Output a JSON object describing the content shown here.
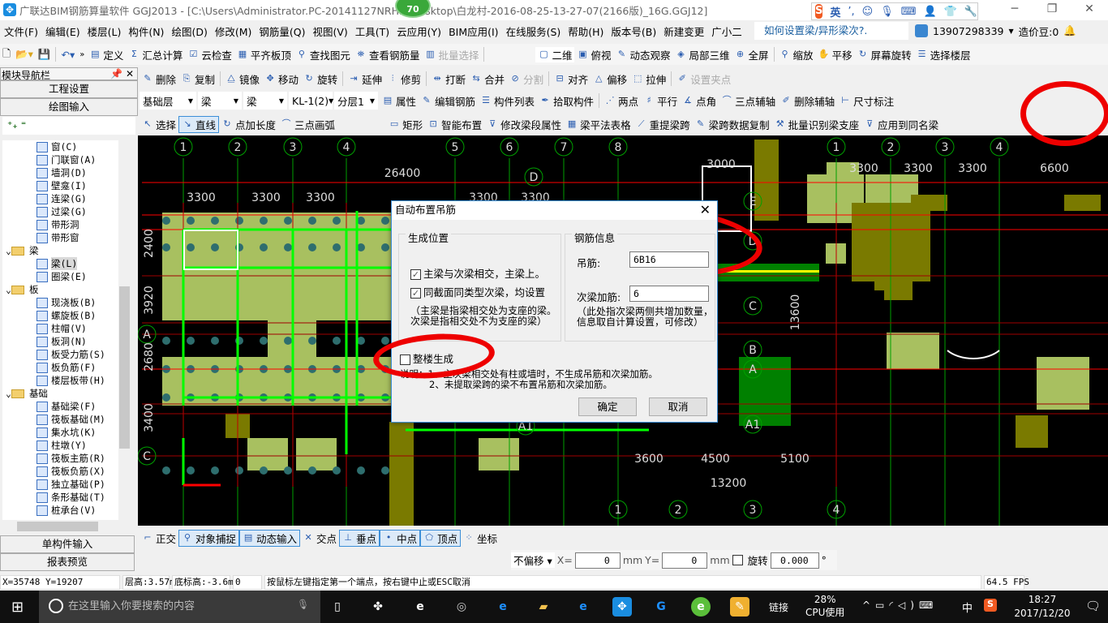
{
  "window": {
    "title": "广联达BIM钢筋算量软件 GGJ2013 - [C:\\Users\\Administrator.PC-20141127NRHM\\Desktop\\白龙村-2016-08-25-13-27-07(2166版)_16G.GGJ12]",
    "badge": "70",
    "ime": {
      "lang": "英",
      "punct": "’,"
    }
  },
  "menu": [
    "文件(F)",
    "编辑(E)",
    "楼层(L)",
    "构件(N)",
    "绘图(D)",
    "修改(M)",
    "钢筋量(Q)",
    "视图(V)",
    "工具(T)",
    "云应用(Y)",
    "BIM应用(I)",
    "在线服务(S)",
    "帮助(H)",
    "版本号(B)",
    "新建变更",
    "广小二"
  ],
  "help_query": "如何设置梁/异形梁次?.",
  "user": {
    "phone": "13907298339",
    "beans": "造价豆:0"
  },
  "toolbar1": [
    "定义",
    "汇总计算",
    "云检查",
    "平齐板顶",
    "查找图元",
    "查看钢筋量",
    "批量选择",
    "二维",
    "俯视",
    "动态观察",
    "局部三维",
    "全屏",
    "缩放",
    "平移",
    "屏幕旋转",
    "选择楼层"
  ],
  "toolbar2": [
    "删除",
    "复制",
    "镜像",
    "移动",
    "旋转",
    "延伸",
    "修剪",
    "打断",
    "合并",
    "分割",
    "对齐",
    "偏移",
    "拉伸",
    "设置夹点"
  ],
  "toolbar3": {
    "floor": "基础层",
    "type": "梁",
    "subtype": "梁",
    "component": "KL-1(2)",
    "layer": "分层1",
    "buttons": [
      "属性",
      "编辑钢筋",
      "构件列表",
      "拾取构件",
      "两点",
      "平行",
      "点角",
      "三点辅轴",
      "删除辅轴",
      "尺寸标注"
    ]
  },
  "toolbar4": [
    "选择",
    "直线",
    "点加长度",
    "三点画弧",
    "矩形",
    "智能布置",
    "修改梁段属性",
    "梁平法表格",
    "重提梁跨",
    "梁跨数据复制",
    "批量识别梁支座",
    "应用到同名梁"
  ],
  "nav": {
    "title": "模块导航栏",
    "project_settings": "工程设置",
    "drawing_input": "绘图输入",
    "single_input": "单构件输入",
    "report_preview": "报表预览"
  },
  "tree": [
    {
      "label": "窗(C)",
      "level": 2
    },
    {
      "label": "门联窗(A)",
      "level": 2
    },
    {
      "label": "墙洞(D)",
      "level": 2
    },
    {
      "label": "壁龛(I)",
      "level": 2
    },
    {
      "label": "连梁(G)",
      "level": 2
    },
    {
      "label": "过梁(G)",
      "level": 2
    },
    {
      "label": "带形洞",
      "level": 2
    },
    {
      "label": "带形窗",
      "level": 2
    },
    {
      "label": "梁",
      "level": 1
    },
    {
      "label": "梁(L)",
      "level": 2,
      "selected": true
    },
    {
      "label": "圈梁(E)",
      "level": 2
    },
    {
      "label": "板",
      "level": 1
    },
    {
      "label": "现浇板(B)",
      "level": 2
    },
    {
      "label": "螺旋板(B)",
      "level": 2
    },
    {
      "label": "柱帽(V)",
      "level": 2
    },
    {
      "label": "板洞(N)",
      "level": 2
    },
    {
      "label": "板受力筋(S)",
      "level": 2
    },
    {
      "label": "板负筋(F)",
      "level": 2
    },
    {
      "label": "楼层板带(H)",
      "level": 2
    },
    {
      "label": "基础",
      "level": 1
    },
    {
      "label": "基础梁(F)",
      "level": 2
    },
    {
      "label": "筏板基础(M)",
      "level": 2
    },
    {
      "label": "集水坑(K)",
      "level": 2
    },
    {
      "label": "柱墩(Y)",
      "level": 2
    },
    {
      "label": "筏板主筋(R)",
      "level": 2
    },
    {
      "label": "筏板负筋(X)",
      "level": 2
    },
    {
      "label": "独立基础(P)",
      "level": 2
    },
    {
      "label": "条形基础(T)",
      "level": 2
    },
    {
      "label": "桩承台(V)",
      "level": 2
    }
  ],
  "canvas": {
    "axes": [
      {
        "t": "1"
      },
      {
        "t": "2"
      },
      {
        "t": "3"
      },
      {
        "t": "4"
      },
      {
        "t": "5"
      },
      {
        "t": "6"
      },
      {
        "t": "7"
      },
      {
        "t": "8"
      },
      {
        "t": "1"
      },
      {
        "t": "2"
      },
      {
        "t": "3"
      },
      {
        "t": "4"
      },
      {
        "t": "1"
      },
      {
        "t": "2"
      },
      {
        "t": "3"
      },
      {
        "t": "4"
      },
      {
        "t": "D"
      },
      {
        "t": "E"
      },
      {
        "t": "D"
      },
      {
        "t": "C"
      },
      {
        "t": "B"
      },
      {
        "t": "A"
      },
      {
        "t": "A1"
      },
      {
        "t": "A"
      },
      {
        "t": "C"
      },
      {
        "t": "A1"
      }
    ],
    "dims": [
      "26400",
      "3300",
      "3300",
      "3300",
      "3300",
      "3300",
      "3000",
      "3300",
      "3300",
      "3300",
      "6600",
      "3600",
      "4500",
      "5100",
      "13200",
      "13600",
      "2400",
      "3920",
      "3400",
      "2680"
    ]
  },
  "dialog": {
    "title": "自动布置吊筋",
    "position_group": "生成位置",
    "opt1": "主梁与次梁相交，主梁上。",
    "opt1_checked": true,
    "opt2": "同截面同类型次梁，均设置",
    "opt2_checked": true,
    "note1": "（主梁是指梁相交处为支座的梁。",
    "note2": "次梁是指相交处不为支座的梁）",
    "rebar_group": "钢筋信息",
    "hanger_label": "吊筋:",
    "hanger_value": "6B16",
    "secondary_label": "次梁加筋:",
    "secondary_value": "6",
    "note3": "（此处指次梁两侧共增加数量，",
    "note4": "信息取自计算设置，可修改）",
    "whole_building": "整楼生成",
    "whole_building_checked": false,
    "desc1": "说明：1、主次梁相交处有柱或墙时，不生成吊筋和次梁加筋。",
    "desc2": "2、未提取梁跨的梁不布置吊筋和次梁加筋。",
    "ok": "确定",
    "cancel": "取消"
  },
  "snapbar": [
    "正交",
    "对象捕捉",
    "动态输入",
    "交点",
    "垂点",
    "中点",
    "顶点",
    "坐标"
  ],
  "offsetbar": {
    "mode": "不偏移",
    "x_label": "X=",
    "x": "0",
    "y_label": "Y=",
    "y": "0",
    "unit": "mm",
    "rotate_label": "旋转",
    "rotate": "0.000",
    "deg": "°"
  },
  "status": {
    "coords": "X=35748 Y=19207",
    "floor_height": "层高:3.57m",
    "base_elev": "底标高:-3.6m",
    "count": "0",
    "hint": "按鼠标左键指定第一个端点，按右键中止或ESC取消",
    "fps": "64.5 FPS"
  },
  "taskbar": {
    "search_placeholder": "在这里输入你要搜索的内容",
    "link": "链接",
    "cpu_pct": "28%",
    "cpu_label": "CPU使用",
    "ime": "中",
    "time": "18:27",
    "date": "2017/12/20"
  },
  "colors": {
    "annotation": "#e00000",
    "canvas_bg": "#000000",
    "grid_green": "#00a000",
    "beam_green": "#00ff00",
    "axis_red": "#ff0000"
  }
}
